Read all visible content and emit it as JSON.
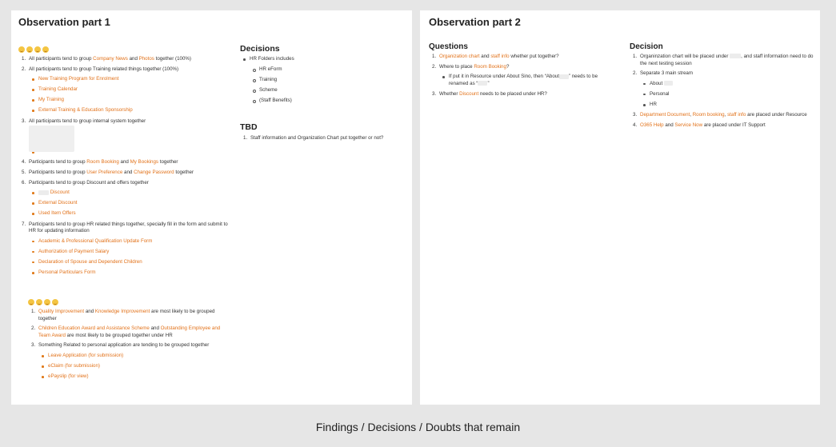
{
  "part1": {
    "title": "Observation part 1",
    "left": {
      "emoji_group_1": [
        "emoji",
        "emoji",
        "emoji",
        "emoji"
      ],
      "items": [
        {
          "num": "1.",
          "parts": [
            [
              "All participants tend to group ",
              false
            ],
            [
              "Company News",
              true
            ],
            [
              " and ",
              false
            ],
            [
              "Photos",
              true
            ],
            [
              " together (100%)",
              false
            ]
          ]
        },
        {
          "num": "2.",
          "parts": [
            [
              "All participants tend to group Training related things together (100%)",
              false
            ]
          ],
          "sub": [
            "New Training Program for Enrolment",
            "Training Calendar",
            "My Training",
            "External Training & Education Sponsorship"
          ]
        },
        {
          "num": "3.",
          "parts": [
            [
              "All participants tend to group internal system together",
              false
            ]
          ],
          "sub_blank": 3
        },
        {
          "num": "4.",
          "parts": [
            [
              "Participants tend to group ",
              false
            ],
            [
              "Room Booking",
              true
            ],
            [
              " and ",
              false
            ],
            [
              "My Bookings",
              true
            ],
            [
              " together",
              false
            ]
          ]
        },
        {
          "num": "5.",
          "parts": [
            [
              "Participants tend to group ",
              false
            ],
            [
              "User Preference",
              true
            ],
            [
              " and ",
              false
            ],
            [
              "Change Password",
              true
            ],
            [
              " together",
              false
            ]
          ]
        },
        {
          "num": "6.",
          "parts": [
            [
              "Participants tend to group Discount and offers together",
              false
            ]
          ],
          "sub": [
            "Discount",
            "External Discount",
            "Used Item Offers"
          ]
        },
        {
          "num": "7.",
          "parts": [
            [
              "Participants tend to group HR related things together, specially fill in the form and submit to HR for updating information",
              false
            ]
          ],
          "sub": [
            "Academic & Professional Qualification Update Form",
            "Authorization of Payment Salary",
            "Declaration of Spouse and Dependent Children",
            "Personal Particulars Form"
          ]
        }
      ],
      "emoji_group_2": [
        "emoji",
        "emoji",
        "emoji",
        "emoji"
      ],
      "items2": [
        {
          "num": "1.",
          "parts": [
            [
              "Quality Improvement",
              true
            ],
            [
              " and ",
              false
            ],
            [
              "Knowledge Improvement",
              true
            ],
            [
              " are most likely to be grouped together",
              false
            ]
          ]
        },
        {
          "num": "2.",
          "parts": [
            [
              "Children Education Award and Assistance Scheme",
              true
            ],
            [
              " and ",
              false
            ],
            [
              "Outstanding Employee and Team Award",
              true
            ],
            [
              " are most likely to be grouped together under HR",
              false
            ]
          ]
        },
        {
          "num": "3.",
          "parts": [
            [
              "Something Related to personal application are tending to be grouped together",
              false
            ]
          ],
          "sub": [
            "Leave Application (for submission)",
            "eClaim (for submission)",
            "ePayslip (for view)"
          ]
        }
      ]
    },
    "right": {
      "decisions_title": "Decisions",
      "decisions_item": "HR Folders includes",
      "decisions_sub": [
        "HR eForm",
        "Training",
        "Scheme",
        "(Staff Benefits)"
      ],
      "tbd_title": "TBD",
      "tbd_items": [
        "Staff information and Organization Chart put together or not?"
      ]
    }
  },
  "part2": {
    "title": "Observation part 2",
    "questions_title": "Questions",
    "questions": [
      {
        "num": "1.",
        "parts": [
          [
            "Organization chart",
            true
          ],
          [
            " and ",
            false
          ],
          [
            "staff info",
            true
          ],
          [
            " whether put together?",
            false
          ]
        ]
      },
      {
        "num": "2.",
        "parts": [
          [
            "Where to place ",
            false
          ],
          [
            "Room Booking",
            true
          ],
          [
            "?",
            false
          ]
        ],
        "sub_text": [
          "If put it in Resource under About Sino, then “About",
          "” needs to be renamed as “",
          "”"
        ]
      },
      {
        "num": "3.",
        "parts": [
          [
            "Whether ",
            false
          ],
          [
            "Discount",
            true
          ],
          [
            " needs to be placed under HR?",
            false
          ]
        ]
      }
    ],
    "decision_title": "Decision",
    "decisions": [
      {
        "num": "1.",
        "parts": [
          [
            "Organinzation chart will be placed under ",
            false
          ],
          [
            "",
            false
          ],
          [
            ", and staff information need to do the next testing session",
            false
          ]
        ]
      },
      {
        "num": "2.",
        "parts": [
          [
            "Separate 3 main stream",
            false
          ]
        ],
        "sub": [
          "About",
          "Personal",
          "HR"
        ]
      },
      {
        "num": "3.",
        "parts": [
          [
            "Department Document",
            true
          ],
          [
            ", ",
            false
          ],
          [
            "Room booking",
            true
          ],
          [
            ", ",
            false
          ],
          [
            "staff info",
            true
          ],
          [
            " are placed under Resource",
            false
          ]
        ]
      },
      {
        "num": "4.",
        "parts": [
          [
            "O365 Help",
            true
          ],
          [
            " and ",
            false
          ],
          [
            "Service Now",
            true
          ],
          [
            " are placed under IT Support",
            false
          ]
        ]
      }
    ]
  },
  "caption": "Findings / Decisions / Doubts that remain",
  "colors": {
    "accent": "#e2721a",
    "background": "#e6e6e6",
    "card": "#ffffff"
  }
}
